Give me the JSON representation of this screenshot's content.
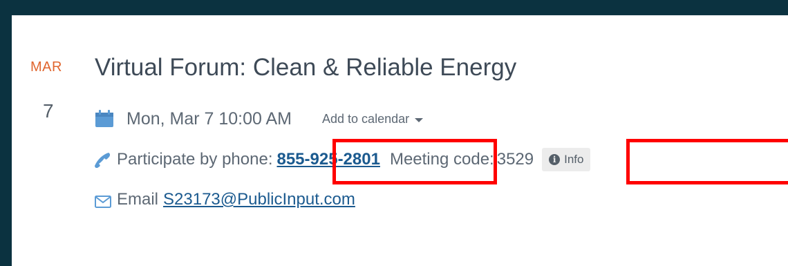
{
  "event": {
    "month": "MAR",
    "day": "7",
    "title": "Virtual Forum: Clean & Reliable Energy",
    "datetime": "Mon, Mar 7 10:00 AM",
    "add_to_calendar": "Add to calendar",
    "phone": {
      "label": "Participate by phone:",
      "number": "855-925-2801",
      "code_label": "Meeting code:",
      "code": "3529",
      "info_label": "Info"
    },
    "email": {
      "label": "Email",
      "address": "S23173@PublicInput.com"
    }
  },
  "icons": {
    "calendar": "calendar-icon",
    "phone": "phone-icon",
    "email": "envelope-icon",
    "info": "info-circle-icon",
    "caret": "caret-down-icon"
  },
  "colors": {
    "background": "#0b3240",
    "month_accent": "#e0652e",
    "link": "#1b5a8f",
    "icon_blue": "#5b9bd5",
    "highlight": "#ff0000"
  }
}
